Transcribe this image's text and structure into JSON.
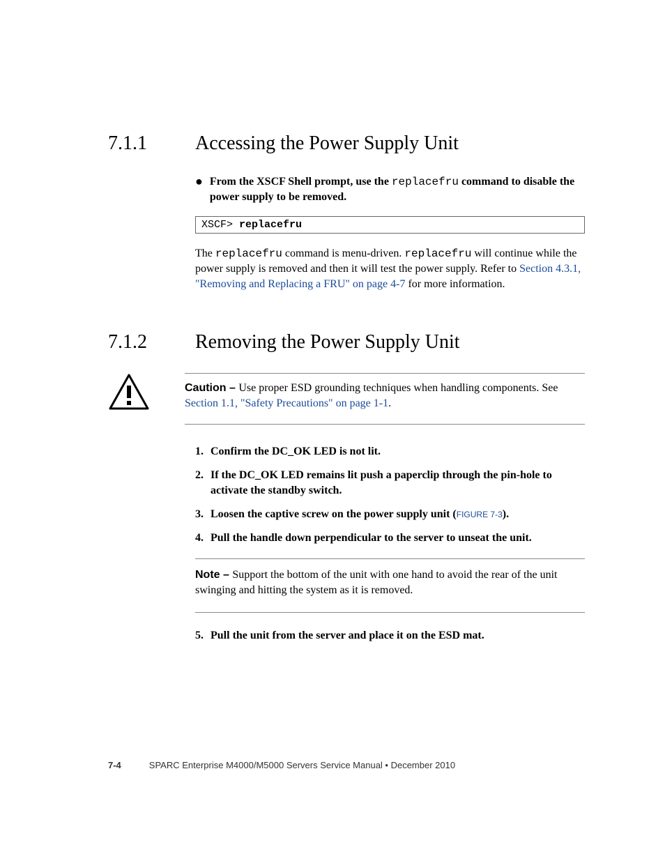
{
  "section1": {
    "number": "7.1.1",
    "title": "Accessing the Power Supply Unit",
    "bullet_pre": "From the XSCF Shell prompt, use the ",
    "bullet_cmd": "replacefru",
    "bullet_post": " command to disable the power supply to be removed.",
    "code_prompt": "XSCF> ",
    "code_cmd": "replacefru",
    "para_a": "The ",
    "para_cmd1": "replacefru",
    "para_b": " command is menu-driven. ",
    "para_cmd2": "replacefru",
    "para_c": " will continue while the power supply is removed and then it will test the power supply. Refer to ",
    "para_link": "Section 4.3.1, \"Removing and Replacing a FRU\" on page 4-7",
    "para_d": " for more information."
  },
  "section2": {
    "number": "7.1.2",
    "title": "Removing the Power Supply Unit",
    "caution_label": "Caution – ",
    "caution_text": "Use proper ESD grounding techniques when handling components. See ",
    "caution_link": "Section 1.1, \"Safety Precautions\" on page 1-1",
    "caution_end": ".",
    "steps": {
      "s1": "Confirm the DC_OK LED is not lit.",
      "s2": "If the DC_OK LED remains lit push a paperclip through the pin-hole to activate the standby switch.",
      "s3a": "Loosen the captive screw on the power supply unit (",
      "s3_fig": "FIGURE 7-3",
      "s3b": ").",
      "s4": "Pull the handle down perpendicular to the server to unseat the unit.",
      "s5": "Pull the unit from the server and place it on the ESD mat."
    },
    "note_label": "Note – ",
    "note_text": "Support the bottom of the unit with one hand to avoid the rear of the unit swinging and hitting the system as it is removed."
  },
  "footer": {
    "page": "7-4",
    "title": "SPARC Enterprise M4000/M5000 Servers Service Manual  •  December 2010"
  }
}
